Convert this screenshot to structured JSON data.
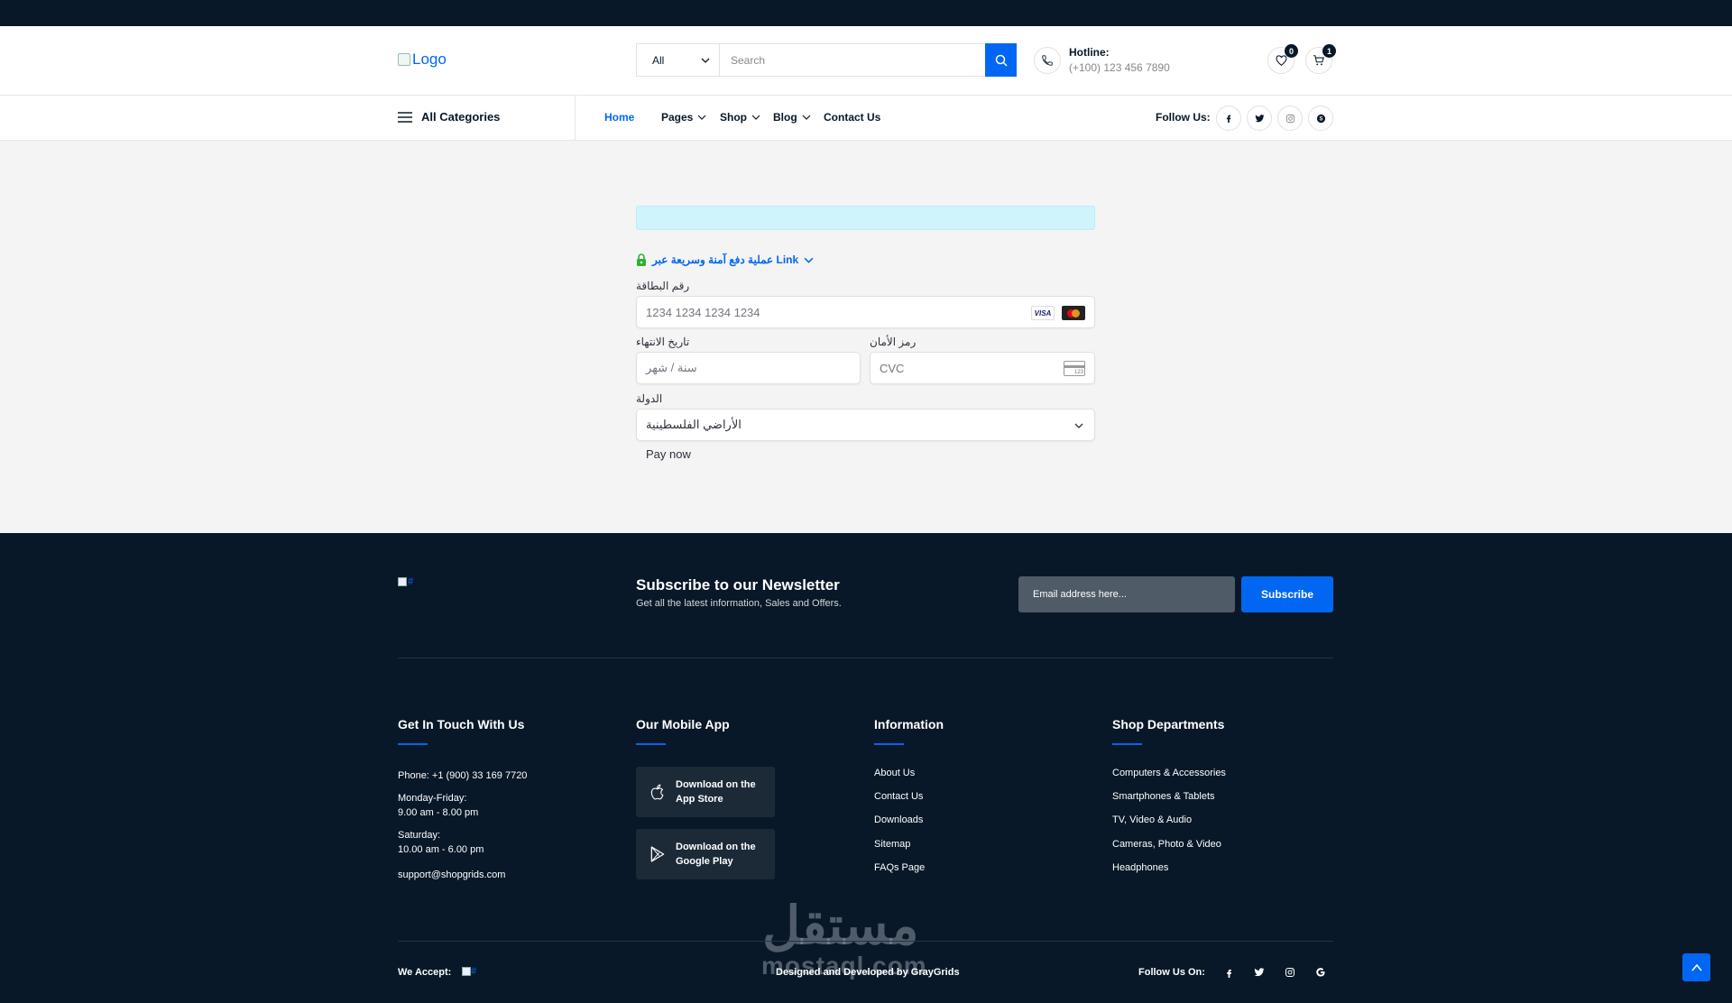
{
  "header": {
    "logo_alt": "Logo",
    "search": {
      "category": "All",
      "placeholder": "Search"
    },
    "hotline": {
      "label": "Hotline:",
      "number": "(+100) 123 456 7890"
    },
    "wishlist_count": "0",
    "cart_count": "1"
  },
  "nav": {
    "all_categories": "All Categories",
    "items": [
      {
        "label": "Home",
        "active": true
      },
      {
        "label": "Pages"
      },
      {
        "label": "Shop"
      },
      {
        "label": "Blog"
      },
      {
        "label": "Contact Us"
      }
    ],
    "follow_label": "Follow Us:"
  },
  "payment": {
    "link_text": "Link عملية دفع آمنة وسريعة عبر",
    "card_number_label": "رقم البطاقة",
    "card_number_placeholder": "1234 1234 1234 1234",
    "card_brands": [
      "VISA",
      "mastercard"
    ],
    "expiry_label": "تاريخ الانتهاء",
    "expiry_placeholder": "سنة / شهر",
    "cvc_label": "رمز الأمان",
    "cvc_placeholder": "CVC",
    "cvc_icon_text": "123",
    "country_label": "الدولة",
    "country_value": "الأراضي الفلسطينية",
    "pay_button": "Pay now"
  },
  "footer": {
    "logo_alt": "#",
    "newsletter": {
      "title": "Subscribe to our Newsletter",
      "subtitle": "Get all the latest information, Sales and Offers.",
      "email_placeholder": "Email address here...",
      "button": "Subscribe"
    },
    "contact": {
      "title": "Get In Touch With Us",
      "phone": "Phone: +1 (900) 33 169 7720",
      "weekdays_label": "Monday-Friday:",
      "weekdays_hours": "9.00 am - 8.00 pm",
      "saturday_label": "Saturday:",
      "saturday_hours": "10.00 am - 6.00 pm",
      "email": "support@shopgrids.com"
    },
    "mobile_app": {
      "title": "Our Mobile App",
      "app_store": [
        "Download on the",
        "App Store"
      ],
      "google_play": [
        "Download on the",
        "Google Play"
      ]
    },
    "information": {
      "title": "Information",
      "links": [
        "About Us",
        "Contact Us",
        "Downloads",
        "Sitemap",
        "FAQs Page"
      ]
    },
    "departments": {
      "title": "Shop Departments",
      "links": [
        "Computers & Accessories",
        "Smartphones & Tablets",
        "TV, Video & Audio",
        "Cameras, Photo & Video",
        "Headphones"
      ]
    },
    "bottom": {
      "we_accept": "We Accept:",
      "accept_img_alt": "#",
      "designed_by": "Designed and Developed by GrayGrids",
      "follow_label": "Follow Us On:"
    },
    "watermark": {
      "arabic": "مستقل",
      "latin": "mostaql.com"
    }
  },
  "colors": {
    "accent": "#0167f3",
    "dark": "#081828",
    "alert_bg": "#cff4fc",
    "green_lock": "#30b130"
  }
}
